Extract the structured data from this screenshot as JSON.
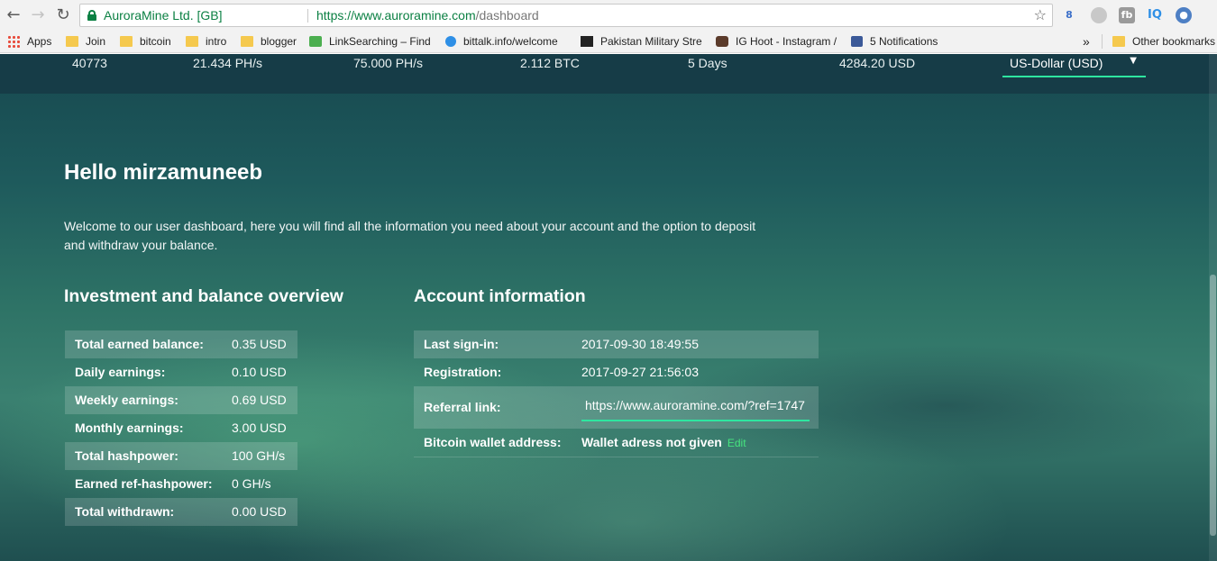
{
  "browser": {
    "ev_name": "AuroraMine Ltd. [GB]",
    "url_host": "https://www.auroramine.com",
    "url_path": "/dashboard",
    "bookmarks": [
      {
        "label": "Apps",
        "icon": "apps-grid-icon"
      },
      {
        "label": "Join",
        "icon": "folder-icon"
      },
      {
        "label": "bitcoin",
        "icon": "folder-icon"
      },
      {
        "label": "intro",
        "icon": "folder-icon"
      },
      {
        "label": "blogger",
        "icon": "folder-icon"
      },
      {
        "label": "LinkSearching – Find",
        "icon": "search-icon"
      },
      {
        "label": "bittalk.info/welcome",
        "icon": "bitcoin-icon"
      },
      {
        "label": "Pakistan Military Stre",
        "icon": "newspaper-icon"
      },
      {
        "label": "IG Hoot - Instagram /",
        "icon": "camera-icon"
      },
      {
        "label": "5 Notifications",
        "icon": "facebook-icon"
      }
    ],
    "overflow": "»",
    "other_bookmarks": "Other bookmarks",
    "extensions": [
      "8",
      "fb",
      "IQ"
    ]
  },
  "stats": {
    "col1": "40773",
    "col2": "21.434 PH/s",
    "col3": "75.000 PH/s",
    "col4": "2.112 BTC",
    "col5": "5 Days",
    "col6": "4284.20 USD",
    "currency": "US-Dollar (USD)",
    "caret": "▼"
  },
  "greeting": "Hello mirzamuneeb",
  "welcome_text": "Welcome to our user dashboard, here you will find all the information you need about your account and the option to deposit and withdraw your balance.",
  "investment": {
    "title": "Investment and balance overview",
    "rows": [
      {
        "label": "Total earned balance:",
        "value": "0.35 USD"
      },
      {
        "label": "Daily earnings:",
        "value": "0.10 USD"
      },
      {
        "label": "Weekly earnings:",
        "value": "0.69 USD"
      },
      {
        "label": "Monthly earnings:",
        "value": "3.00 USD"
      },
      {
        "label": "Total hashpower:",
        "value": "100 GH/s"
      },
      {
        "label": "Earned ref-hashpower:",
        "value": "0 GH/s"
      },
      {
        "label": "Total withdrawn:",
        "value": "0.00 USD"
      }
    ]
  },
  "account": {
    "title": "Account information",
    "last_signin_label": "Last sign-in:",
    "last_signin_value": "2017-09-30 18:49:55",
    "registration_label": "Registration:",
    "registration_value": "2017-09-27 21:56:03",
    "referral_label": "Referral link:",
    "referral_value": "https://www.auroramine.com/?ref=1747",
    "wallet_label": "Bitcoin wallet address:",
    "wallet_value": "Wallet adress not given",
    "edit_label": "Edit"
  }
}
